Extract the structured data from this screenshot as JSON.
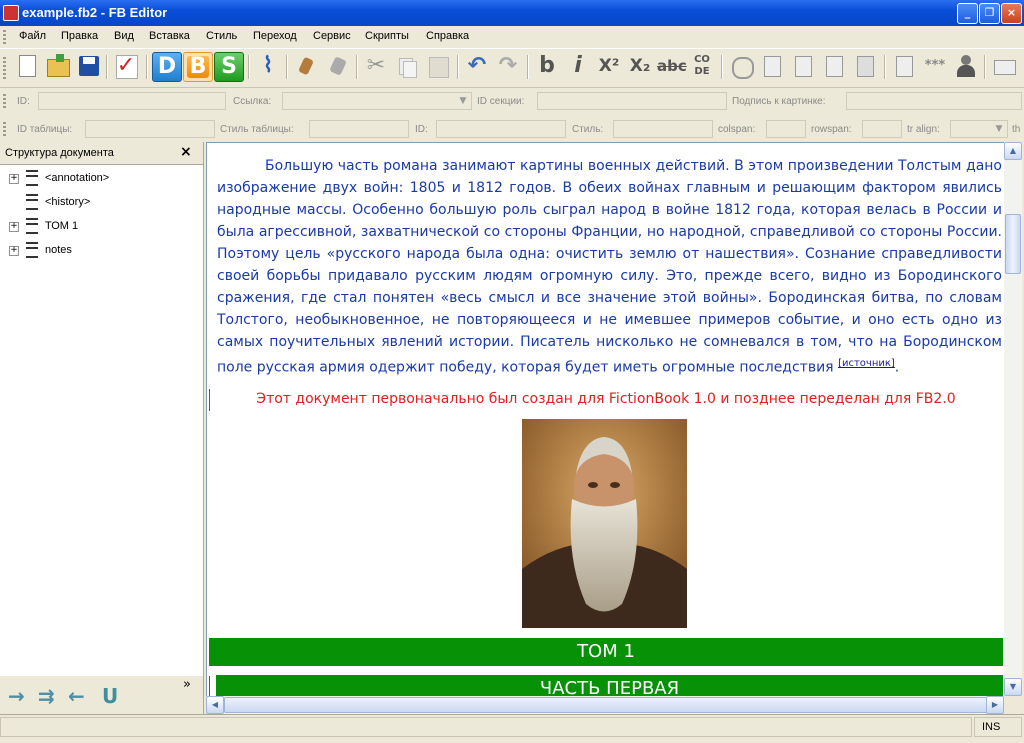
{
  "window": {
    "title": "example.fb2 - FB Editor",
    "min_label": "_",
    "max_label": "❐",
    "close_label": "×"
  },
  "menu": [
    "Файл",
    "Правка",
    "Вид",
    "Вставка",
    "Стиль",
    "Переход",
    "Сервис",
    "Скрипты",
    "Справка"
  ],
  "toolbar_glyphs": {
    "bold": "b",
    "italic": "i",
    "superscript": "X²",
    "subscript": "X₂",
    "strike": "abc",
    "code": "CO DE",
    "stars": "***",
    "d": "D",
    "b": "B",
    "s": "S"
  },
  "fields_row1": {
    "id_label": "ID:",
    "link_label": "Ссылка:",
    "section_id_label": "ID секции:",
    "image_caption_label": "Подпись к картинке:"
  },
  "fields_row2": {
    "table_id_label": "ID таблицы:",
    "table_style_label": "Стиль таблицы:",
    "id_label": "ID:",
    "style_label": "Стиль:",
    "colspan_label": "colspan:",
    "rowspan_label": "rowspan:",
    "tr_align_label": "tr align:",
    "tail": "th"
  },
  "structure_panel": {
    "title": "Структура документа",
    "close": "×",
    "items": [
      {
        "label": "<annotation>",
        "expandable": true
      },
      {
        "label": "<history>",
        "expandable": false
      },
      {
        "label": "ТОМ 1",
        "expandable": true
      },
      {
        "label": "notes",
        "expandable": true
      }
    ],
    "more": "»",
    "actions": [
      "→",
      "⇉",
      "←",
      "U"
    ]
  },
  "document": {
    "paragraph": "Большую часть романа занимают картины военных действий. В этом произведении Толстым дано изображение двух войн: 1805 и 1812 годов. В обеих войнах главным и решающим фактором явились народные массы. Особенно большую роль сыграл народ в войне 1812 года, которая велась в России и была агрессивной, захватнической со стороны Франции, но народной, справедливой со стороны России. Поэтому цель «русского народа была одна: очистить землю от нашествия». Сознание справедливости своей борьбы придавало русским людям огромную силу. Это, прежде всего, видно из Бородинского сражения, где стал понятен «весь смысл и все значение этой войны». Бородинская битва, по словам Толстого, необыкновенное, не повторяющееся и не имевшее примеров событие, и оно есть одно из самых поучительных явлений истории. Писатель нисколько не сомневался в том, что на Бородинском поле русская армия одержит победу, которая будет иметь огромные последствия",
    "source_link": "[источник]",
    "period": ".",
    "note": "Этот документ первоначально был создан для FictionBook 1.0 и позднее переделан для FB2.0",
    "volume_title": "ТОМ 1",
    "part_title": "ЧАСТЬ ПЕРВАЯ"
  },
  "status": {
    "mode": "INS"
  },
  "colors": {
    "title_green": "#079107",
    "paragraph_blue": "#1a3aa8",
    "note_red": "#e02020"
  }
}
